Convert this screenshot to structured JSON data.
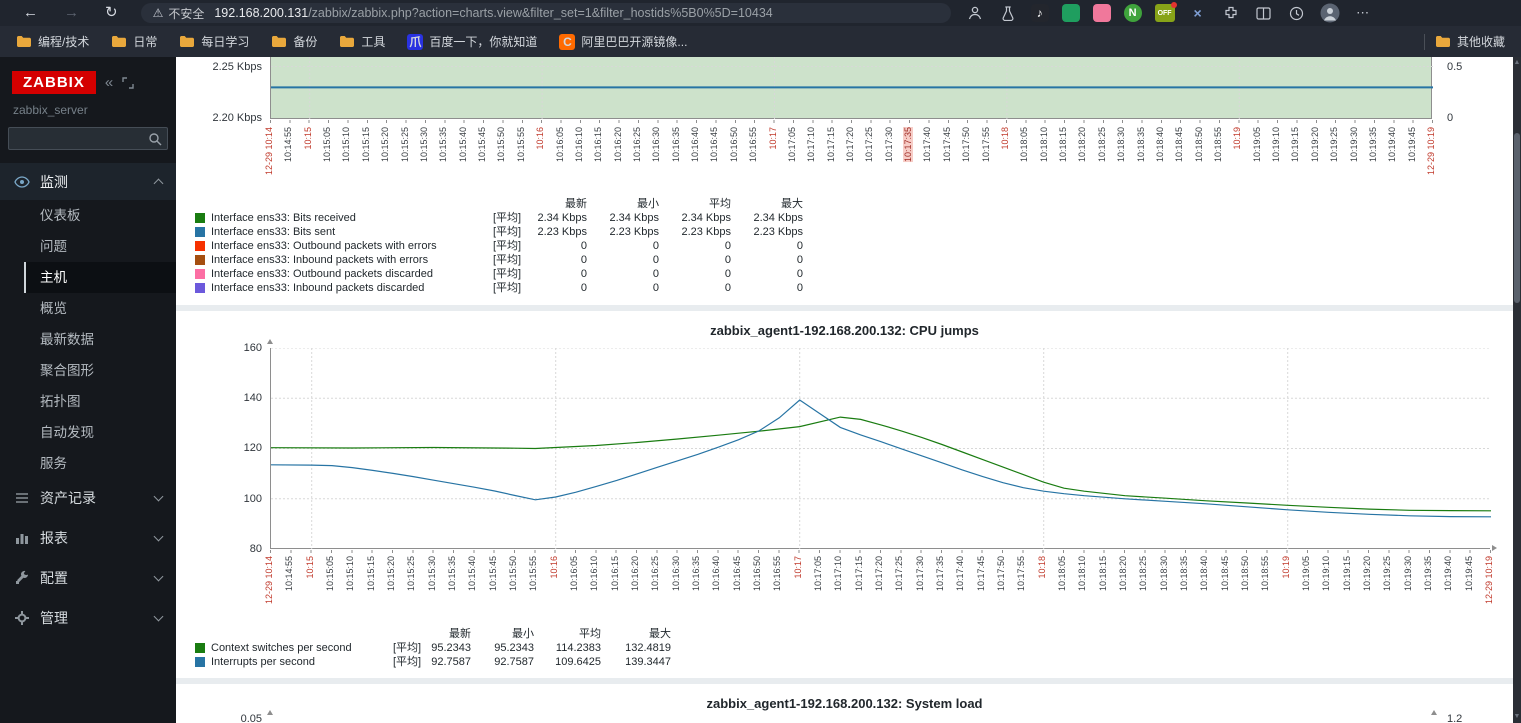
{
  "icons": {
    "back": "←",
    "forward": "→",
    "refresh": "↻",
    "warning": "⚠",
    "collapse": "«",
    "more": "⋯",
    "close_x": "×",
    "douyin_note": "♪",
    "off_badge": "OFF",
    "nutstore_n": "N",
    "scroll_up": "▲",
    "scroll_down": "▼"
  },
  "browser": {
    "security_text": "不安全",
    "url_host": "192.168.200.131",
    "url_path": "/zabbix/zabbix.php?action=charts.view&filter_set=1&filter_hostids%5B0%5D=10434",
    "bookmarks": [
      "编程/技术",
      "日常",
      "每日学习",
      "备份",
      "工具"
    ],
    "bookmark_sites": [
      "百度一下，你就知道",
      "阿里巴巴开源镜像..."
    ],
    "other_bookmarks": "其他收藏"
  },
  "sidebar": {
    "logo_text": "ZABBIX",
    "server_name": "zabbix_server",
    "monitoring_label": "监测",
    "monitoring_items": [
      "仪表板",
      "问题",
      "主机",
      "概览",
      "最新数据",
      "聚合图形",
      "拓扑图",
      "自动发现",
      "服务"
    ],
    "active_item": "主机",
    "groups": [
      "资产记录",
      "报表",
      "配置",
      "管理"
    ]
  },
  "time_axis": {
    "labels": [
      "12-29 10:14",
      "10:14:55",
      "10:15",
      "10:15:05",
      "10:15:10",
      "10:15:15",
      "10:15:20",
      "10:15:25",
      "10:15:30",
      "10:15:35",
      "10:15:40",
      "10:15:45",
      "10:15:50",
      "10:15:55",
      "10:16",
      "10:16:05",
      "10:16:10",
      "10:16:15",
      "10:16:20",
      "10:16:25",
      "10:16:30",
      "10:16:35",
      "10:16:40",
      "10:16:45",
      "10:16:50",
      "10:16:55",
      "10:17",
      "10:17:05",
      "10:17:10",
      "10:17:15",
      "10:17:20",
      "10:17:25",
      "10:17:30",
      "10:17:35",
      "10:17:40",
      "10:17:45",
      "10:17:50",
      "10:17:55",
      "10:18",
      "10:18:05",
      "10:18:10",
      "10:18:15",
      "10:18:20",
      "10:18:25",
      "10:18:30",
      "10:18:35",
      "10:18:40",
      "10:18:45",
      "10:18:50",
      "10:18:55",
      "10:19",
      "10:19:05",
      "10:19:10",
      "10:19:15",
      "10:19:20",
      "10:19:25",
      "10:19:30",
      "10:19:35",
      "10:19:40",
      "10:19:45",
      "12-29 10:19"
    ],
    "red_indices": [
      0,
      2,
      14,
      26,
      38,
      50,
      60
    ]
  },
  "chart_data": [
    {
      "type": "area",
      "ytick_labels_left": [
        "2.25 Kbps",
        "2.20 Kbps"
      ],
      "ytick_labels_right": [
        "0.5",
        "0"
      ],
      "highlighted_time_label": "10:17:35",
      "series_visible": [
        {
          "name": "Interface ens33: Bits received",
          "color": "#1A7C11",
          "style": "area",
          "value_kbps": 2.34
        },
        {
          "name": "Interface ens33: Bits sent",
          "color": "#2774A4",
          "style": "line",
          "value_kbps": 2.23
        }
      ],
      "legend": {
        "headers": [
          "最新",
          "最小",
          "平均",
          "最大"
        ],
        "rows": [
          {
            "color": "#1A7C11",
            "label": "Interface ens33: Bits received",
            "func": "[平均]",
            "values": [
              "2.34 Kbps",
              "2.34 Kbps",
              "2.34 Kbps",
              "2.34 Kbps"
            ]
          },
          {
            "color": "#2774A4",
            "label": "Interface ens33: Bits sent",
            "func": "[平均]",
            "values": [
              "2.23 Kbps",
              "2.23 Kbps",
              "2.23 Kbps",
              "2.23 Kbps"
            ]
          },
          {
            "color": "#F63100",
            "label": "Interface ens33: Outbound packets with errors",
            "func": "[平均]",
            "values": [
              "0",
              "0",
              "0",
              "0"
            ]
          },
          {
            "color": "#A54F10",
            "label": "Interface ens33: Inbound packets with errors",
            "func": "[平均]",
            "values": [
              "0",
              "0",
              "0",
              "0"
            ]
          },
          {
            "color": "#FC6EA3",
            "label": "Interface ens33: Outbound packets discarded",
            "func": "[平均]",
            "values": [
              "0",
              "0",
              "0",
              "0"
            ]
          },
          {
            "color": "#6C59DC",
            "label": "Interface ens33: Inbound packets discarded",
            "func": "[平均]",
            "values": [
              "0",
              "0",
              "0",
              "0"
            ]
          }
        ]
      }
    },
    {
      "type": "line",
      "title": "zabbix_agent1-192.168.200.132: CPU jumps",
      "ylim": [
        80,
        160
      ],
      "yticks": [
        160,
        140,
        120,
        100,
        80
      ],
      "series": [
        {
          "name": "Context switches per second",
          "color": "#1A7C11",
          "points": [
            [
              0,
              120.3
            ],
            [
              4,
              120.2
            ],
            [
              8,
              120.4
            ],
            [
              12,
              120.1
            ],
            [
              13,
              120.0
            ],
            [
              14,
              120.4
            ],
            [
              16,
              121.2
            ],
            [
              18,
              122.4
            ],
            [
              20,
              123.8
            ],
            [
              22,
              125.3
            ],
            [
              24,
              126.9
            ],
            [
              26,
              128.7
            ],
            [
              28,
              132.5
            ],
            [
              29,
              131.6
            ],
            [
              30,
              129.4
            ],
            [
              31,
              127.0
            ],
            [
              32,
              124.4
            ],
            [
              33,
              121.6
            ],
            [
              34,
              118.6
            ],
            [
              35,
              115.6
            ],
            [
              36,
              112.6
            ],
            [
              37,
              109.6
            ],
            [
              38,
              106.6
            ],
            [
              39,
              104.2
            ],
            [
              40,
              103.0
            ],
            [
              42,
              101.2
            ],
            [
              44,
              100.2
            ],
            [
              46,
              99.2
            ],
            [
              48,
              98.3
            ],
            [
              50,
              97.4
            ],
            [
              52,
              96.6
            ],
            [
              54,
              95.9
            ],
            [
              56,
              95.4
            ],
            [
              58,
              95.3
            ],
            [
              60,
              95.2
            ]
          ]
        },
        {
          "name": "Interrupts per second",
          "color": "#2774A4",
          "points": [
            [
              0,
              113.5
            ],
            [
              2,
              113.4
            ],
            [
              3,
              113.2
            ],
            [
              4,
              112.4
            ],
            [
              5,
              111.3
            ],
            [
              6,
              110.1
            ],
            [
              7,
              108.8
            ],
            [
              8,
              107.4
            ],
            [
              9,
              106.0
            ],
            [
              10,
              104.6
            ],
            [
              11,
              103.1
            ],
            [
              12,
              101.3
            ],
            [
              13,
              99.6
            ],
            [
              14,
              100.7
            ],
            [
              15,
              102.6
            ],
            [
              16,
              104.9
            ],
            [
              17,
              107.3
            ],
            [
              18,
              109.9
            ],
            [
              19,
              112.5
            ],
            [
              20,
              115.1
            ],
            [
              21,
              117.7
            ],
            [
              22,
              120.5
            ],
            [
              23,
              123.5
            ],
            [
              24,
              127.0
            ],
            [
              25,
              132.2
            ],
            [
              26,
              139.3
            ],
            [
              27,
              133.8
            ],
            [
              28,
              128.4
            ],
            [
              29,
              125.4
            ],
            [
              30,
              122.7
            ],
            [
              31,
              119.9
            ],
            [
              32,
              117.1
            ],
            [
              33,
              114.3
            ],
            [
              34,
              111.5
            ],
            [
              35,
              108.8
            ],
            [
              36,
              106.4
            ],
            [
              37,
              104.4
            ],
            [
              38,
              103.0
            ],
            [
              39,
              102.0
            ],
            [
              40,
              101.2
            ],
            [
              42,
              100.0
            ],
            [
              44,
              99.0
            ],
            [
              46,
              98.0
            ],
            [
              48,
              96.8
            ],
            [
              50,
              95.6
            ],
            [
              52,
              94.6
            ],
            [
              54,
              93.8
            ],
            [
              56,
              93.2
            ],
            [
              58,
              92.9
            ],
            [
              60,
              92.8
            ]
          ]
        }
      ],
      "legend": {
        "headers": [
          "最新",
          "最小",
          "平均",
          "最大"
        ],
        "rows": [
          {
            "color": "#1A7C11",
            "label": "Context switches per second",
            "func": "[平均]",
            "values": [
              "95.2343",
              "95.2343",
              "114.2383",
              "132.4819"
            ]
          },
          {
            "color": "#2774A4",
            "label": "Interrupts per second",
            "func": "[平均]",
            "values": [
              "92.7587",
              "92.7587",
              "109.6425",
              "139.3447"
            ]
          }
        ]
      }
    },
    {
      "type": "line",
      "title": "zabbix_agent1-192.168.200.132: System load",
      "ytick_left": "0.05",
      "ytick_right": "1.2"
    }
  ]
}
